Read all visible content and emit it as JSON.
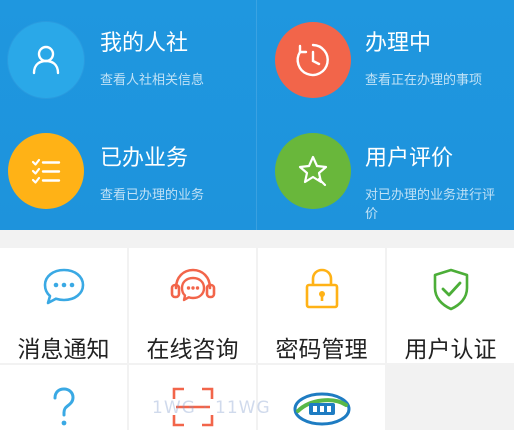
{
  "cards": [
    {
      "title": "我的人社",
      "desc": "查看人社相关信息",
      "color": "#2aa8e8",
      "icon": "person-icon"
    },
    {
      "title": "办理中",
      "desc": "查看正在办理的事项",
      "color": "#f2654a",
      "icon": "clock-icon"
    },
    {
      "title": "已办业务",
      "desc": "查看已办理的业务",
      "color": "#ffb216",
      "icon": "checklist-icon"
    },
    {
      "title": "用户评价",
      "desc": "对已办理的业务进行评价",
      "color": "#69b73b",
      "icon": "star-comment-icon"
    }
  ],
  "grid": [
    {
      "label": "消息通知",
      "icon": "chat-bubble-icon",
      "color": "#3aa9e4"
    },
    {
      "label": "在线咨询",
      "icon": "headset-chat-icon",
      "color": "#f2654a"
    },
    {
      "label": "密码管理",
      "icon": "padlock-icon",
      "color": "#ffb216"
    },
    {
      "label": "用户认证",
      "icon": "shield-check-icon",
      "color": "#4cae38"
    },
    {
      "label": "",
      "icon": "question-icon",
      "color": "#3aa9e4"
    },
    {
      "label": "",
      "icon": "scan-icon",
      "color": "#f2654a"
    },
    {
      "label": "",
      "icon": "app-logo-icon",
      "color": "#1e7cc2"
    }
  ],
  "watermark": "1WG · 11WG"
}
